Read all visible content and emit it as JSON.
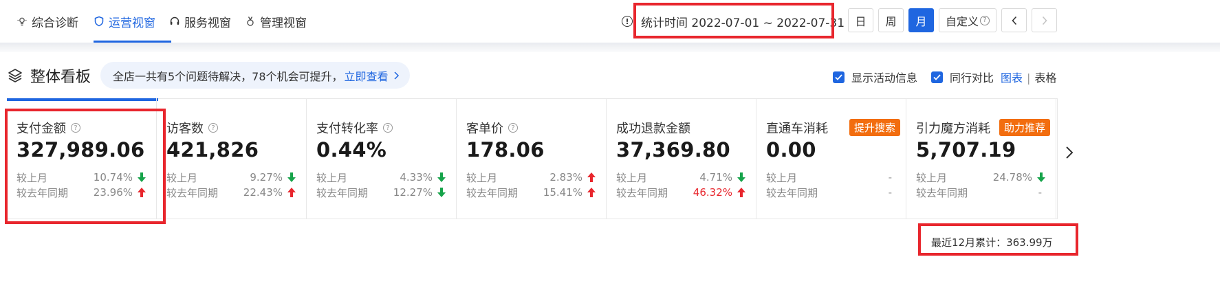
{
  "nav": {
    "tabs": [
      {
        "label": "综合诊断",
        "icon": "bulb-icon"
      },
      {
        "label": "运营视窗",
        "icon": "shield-icon",
        "active": true
      },
      {
        "label": "服务视窗",
        "icon": "headset-icon"
      },
      {
        "label": "管理视窗",
        "icon": "medal-icon"
      }
    ],
    "stat_time": "统计时间 2022-07-01 ~ 2022-07-31",
    "periods": [
      "日",
      "周",
      "月",
      "自定义"
    ],
    "active_period": "月",
    "accent": "#1f66e0"
  },
  "board": {
    "title": "整体看板",
    "notice_text": "全店一共有5个问题待解决，78个机会可提升，",
    "notice_link": "立即查看",
    "show_activity": "显示活动信息",
    "peer_compare": "同行对比",
    "view_chart": "图表",
    "view_table": "表格"
  },
  "cards": [
    {
      "title": "支付金额",
      "help": true,
      "value": "327,989.06",
      "rows": [
        {
          "label": "较上月",
          "pct": "10.74%",
          "dir": "down"
        },
        {
          "label": "较去年同期",
          "pct": "23.96%",
          "dir": "up"
        }
      ]
    },
    {
      "title": "访客数",
      "help": true,
      "value": "421,826",
      "rows": [
        {
          "label": "较上月",
          "pct": "9.27%",
          "dir": "down"
        },
        {
          "label": "较去年同期",
          "pct": "22.43%",
          "dir": "up"
        }
      ]
    },
    {
      "title": "支付转化率",
      "help": true,
      "value": "0.44%",
      "rows": [
        {
          "label": "较上月",
          "pct": "4.33%",
          "dir": "down"
        },
        {
          "label": "较去年同期",
          "pct": "12.27%",
          "dir": "down"
        }
      ]
    },
    {
      "title": "客单价",
      "help": true,
      "value": "178.06",
      "rows": [
        {
          "label": "较上月",
          "pct": "2.83%",
          "dir": "up"
        },
        {
          "label": "较去年同期",
          "pct": "15.41%",
          "dir": "up"
        }
      ]
    },
    {
      "title": "成功退款金额",
      "help": false,
      "value": "37,369.80",
      "rows": [
        {
          "label": "较上月",
          "pct": "4.71%",
          "dir": "down"
        },
        {
          "label": "较去年同期",
          "pct": "46.32%",
          "dir": "up",
          "red": true
        }
      ]
    },
    {
      "title": "直通车消耗",
      "help": false,
      "badge": "提升搜索",
      "value": "0.00",
      "rows": [
        {
          "label": "较上月",
          "pct": "-",
          "dir": "none"
        },
        {
          "label": "较去年同期",
          "pct": "-",
          "dir": "none"
        }
      ]
    },
    {
      "title": "引力魔方消耗",
      "help": false,
      "badge": "助力推荐",
      "value": "5,707.19",
      "rows": [
        {
          "label": "较上月",
          "pct": "24.78%",
          "dir": "down"
        },
        {
          "label": "较去年同期",
          "pct": "-",
          "dir": "none"
        }
      ]
    }
  ],
  "cumulative": "最近12月累计：363.99万",
  "colors": {
    "up": "#e8262d",
    "down": "#16a34a",
    "badge": "#f26d0f",
    "highlight": "#e8262d"
  }
}
